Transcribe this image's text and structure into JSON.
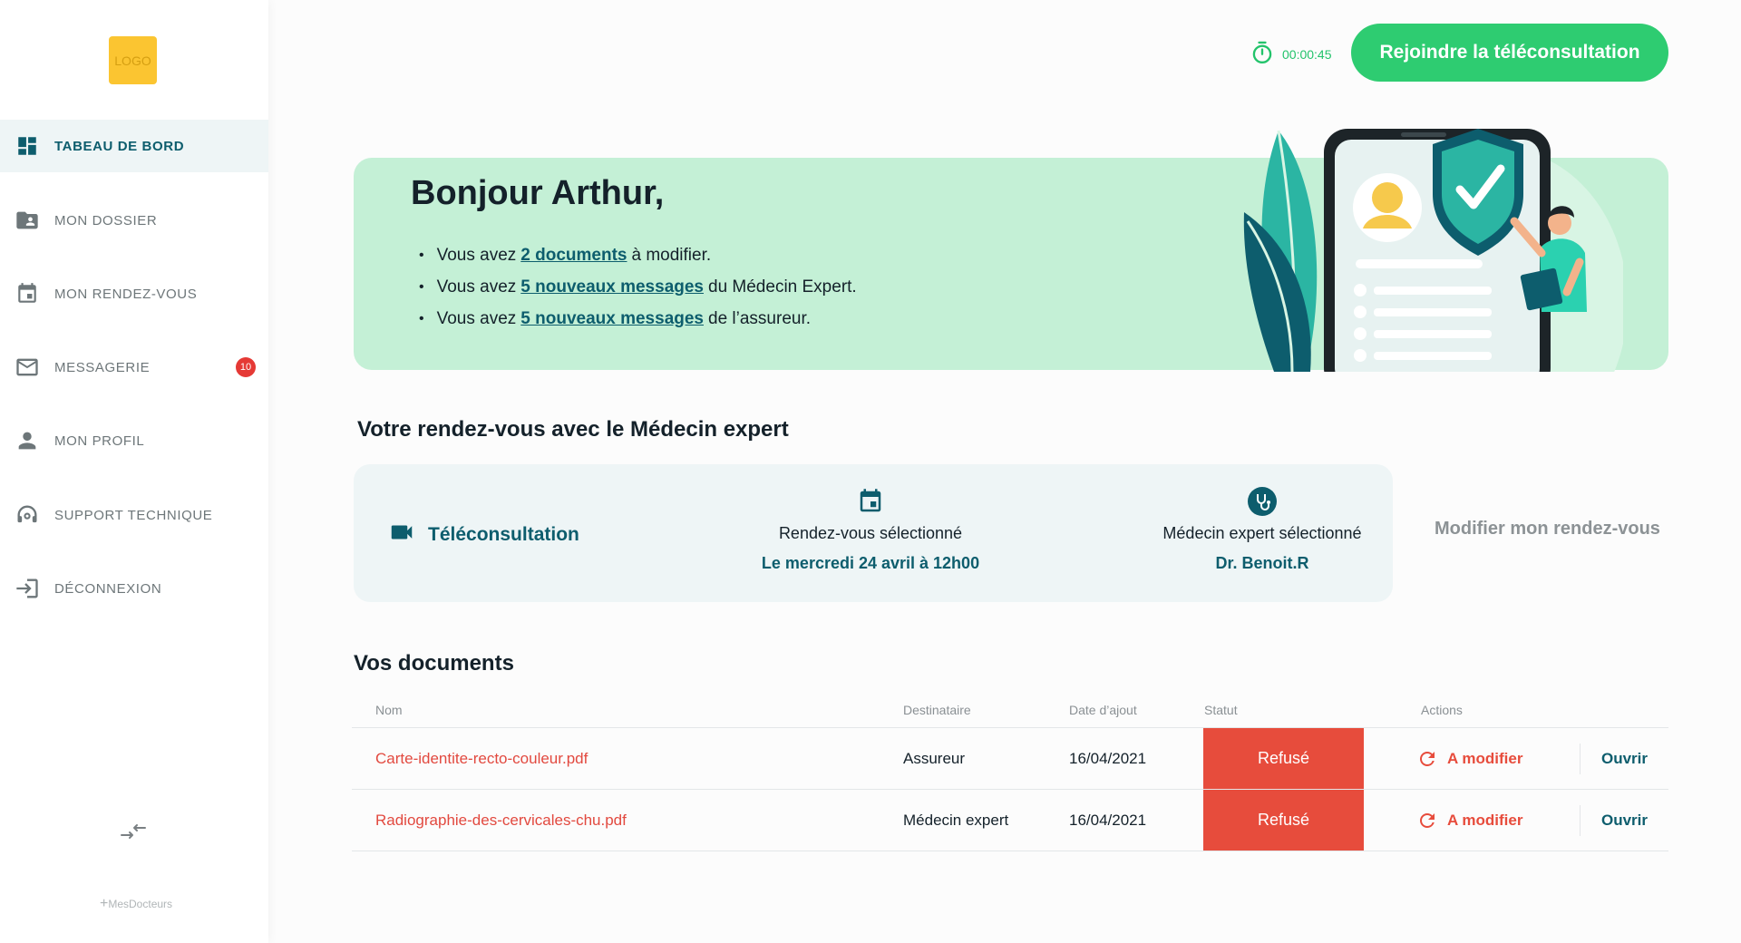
{
  "sidebar": {
    "logo": "LOGO",
    "items": [
      {
        "label": "TABEAU DE BORD",
        "icon": "dashboard-icon",
        "active": true
      },
      {
        "label": "MON DOSSIER",
        "icon": "folder-user-icon"
      },
      {
        "label": "MON RENDEZ-VOUS",
        "icon": "calendar-icon"
      },
      {
        "label": "MESSAGERIE",
        "icon": "mail-icon",
        "badge": "10"
      },
      {
        "label": "MON PROFIL",
        "icon": "person-icon"
      },
      {
        "label": "SUPPORT TECHNIQUE",
        "icon": "support-icon"
      },
      {
        "label": "DÉCONNEXION",
        "icon": "logout-icon"
      }
    ],
    "brand": "MesDocteurs"
  },
  "topbar": {
    "timer": "00:00:45",
    "join_label": "Rejoindre la téléconsultation"
  },
  "welcome": {
    "greeting": "Bonjour Arthur,",
    "notes": [
      {
        "pre": "Vous avez",
        "link": "2 documents",
        "post": "à modifier."
      },
      {
        "pre": "Vous avez",
        "link": "5 nouveaux messages",
        "post": "du Médecin Expert."
      },
      {
        "pre": "Vous avez",
        "link": "5 nouveaux messages",
        "post": "de l’assureur."
      }
    ]
  },
  "appointment": {
    "title": "Votre rendez-vous avec le Médecin expert",
    "type": "Téléconsultation",
    "date_label": "Rendez-vous sélectionné",
    "date_value": "Le mercredi 24 avril à 12h00",
    "doctor_label": "Médecin expert sélectionné",
    "doctor_value": "Dr. Benoit.R",
    "modify_label": "Modifier mon rendez-vous"
  },
  "documents": {
    "title": "Vos documents",
    "columns": [
      "Nom",
      "Destinataire",
      "Date d’ajout",
      "Statut",
      "Actions"
    ],
    "rows": [
      {
        "name": "Carte-identite-recto-couleur.pdf",
        "recipient": "Assureur",
        "date": "16/04/2021",
        "status": "Refusé",
        "action_modify": "A modifier",
        "action_open": "Ouvrir"
      },
      {
        "name": "Radiographie-des-cervicales-chu.pdf",
        "recipient": "Médecin expert",
        "date": "16/04/2021",
        "status": "Refusé",
        "action_modify": "A modifier",
        "action_open": "Ouvrir"
      }
    ]
  },
  "colors": {
    "primary": "#0d5d6d",
    "success": "#2ecc71",
    "danger": "#e74c3c",
    "welcome_bg": "#c4f0d6",
    "card_bg": "#eef5f6",
    "logo_bg": "#fbc531"
  }
}
